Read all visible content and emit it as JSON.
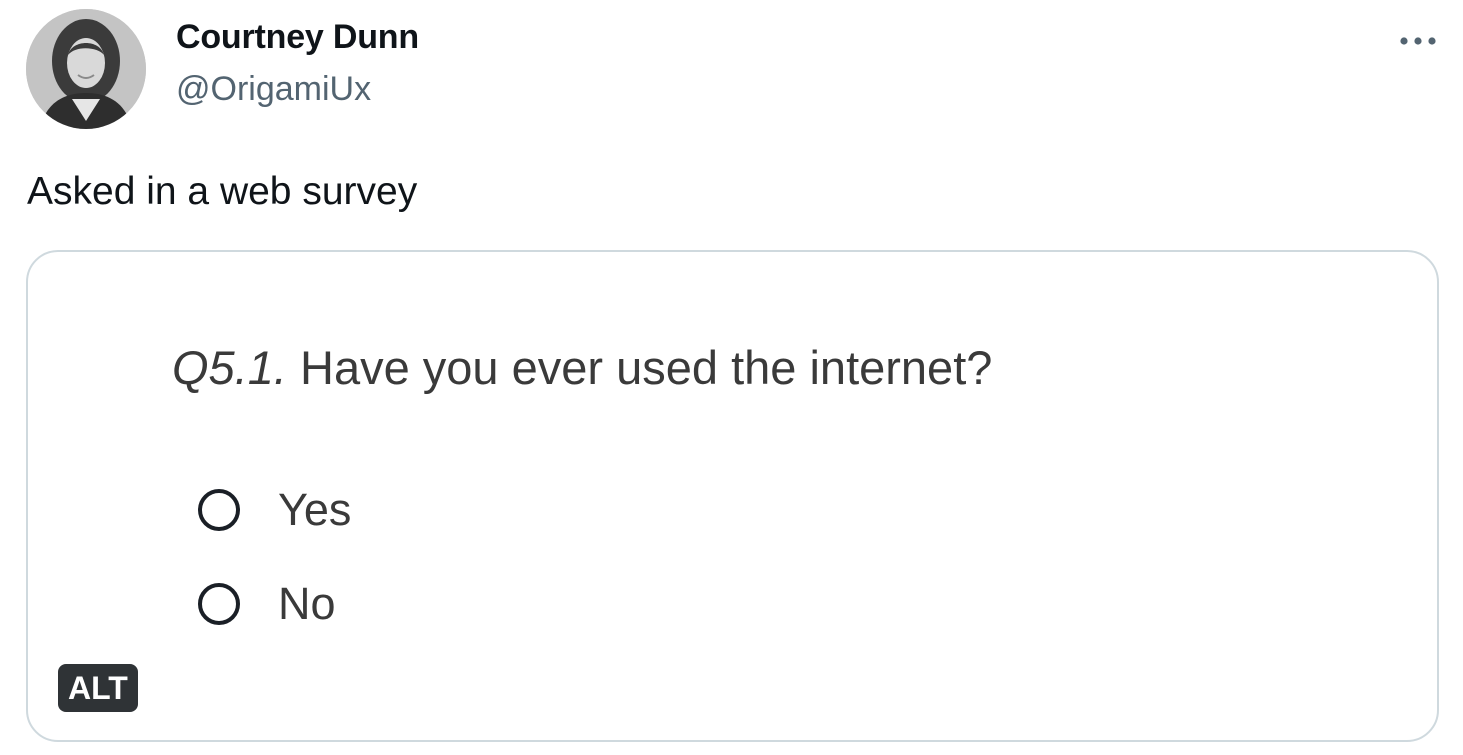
{
  "author": {
    "name": "Courtney Dunn",
    "handle": "@OrigamiUx"
  },
  "tweet": {
    "text": "Asked in a web survey"
  },
  "media": {
    "question_number": "Q5.1.",
    "question_text": " Have you ever used the internet?",
    "options": [
      {
        "label": "Yes",
        "selected": false
      },
      {
        "label": "No",
        "selected": false
      }
    ],
    "alt_badge": "ALT"
  },
  "icons": {
    "more": "more-horizontal-icon"
  },
  "colors": {
    "text_primary": "#0f1419",
    "text_secondary": "#536471",
    "card_border": "#cfd9de",
    "alt_badge_bg": "#2f3336"
  }
}
